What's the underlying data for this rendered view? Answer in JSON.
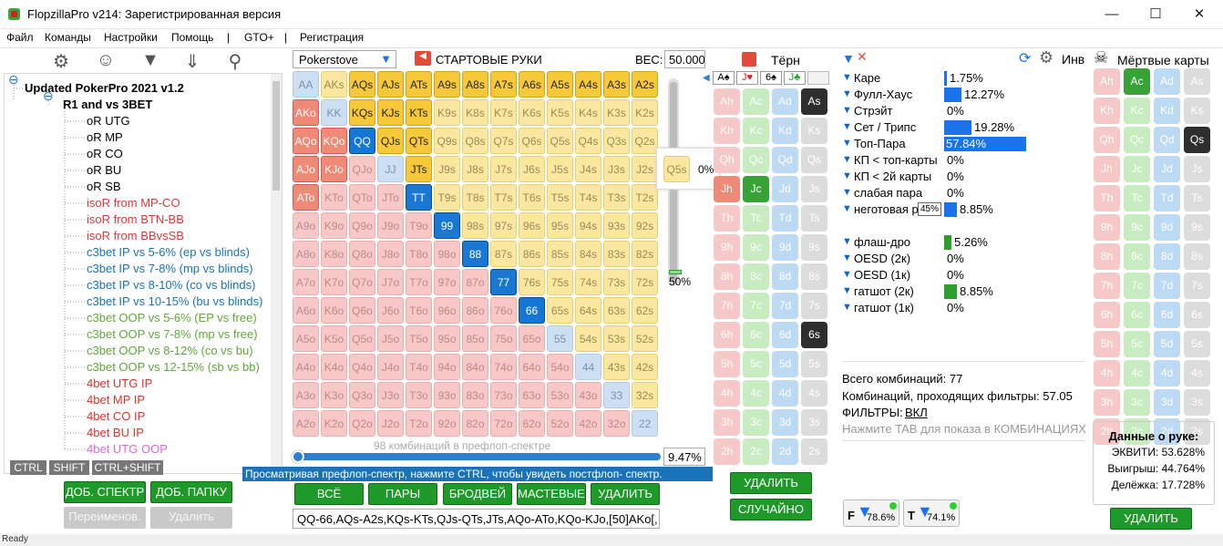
{
  "window": {
    "title": "FlopzillaPro v214: Зарегистрированная версия"
  },
  "menu": [
    "Файл",
    "Команды",
    "Настройки",
    "Помощь",
    "|",
    "GTO+",
    "|",
    "Регистрация"
  ],
  "tree": {
    "root": "Updated PokerPro 2021 v1.2",
    "sub": "R1 and vs 3BET",
    "items": [
      {
        "label": "oR UTG",
        "color": "#000000"
      },
      {
        "label": "oR MP",
        "color": "#000000"
      },
      {
        "label": "oR CO",
        "color": "#000000"
      },
      {
        "label": "oR BU",
        "color": "#000000"
      },
      {
        "label": "oR SB",
        "color": "#000000"
      },
      {
        "label": "isoR from MP-CO",
        "color": "#d83b3b"
      },
      {
        "label": "isoR from BTN-BB",
        "color": "#d83b3b"
      },
      {
        "label": "isoR from BBvsSB",
        "color": "#d83b3b"
      },
      {
        "label": "c3bet IP vs 5-6% (ep vs blinds)",
        "color": "#1a73b8"
      },
      {
        "label": "c3bet IP vs 7-8% (mp vs blinds)",
        "color": "#1a73b8"
      },
      {
        "label": "c3bet IP vs 8-10% (co vs blinds)",
        "color": "#1a73b8"
      },
      {
        "label": "c3bet IP vs 10-15% (bu vs blinds)",
        "color": "#1a73b8"
      },
      {
        "label": "c3bet OOP vs 5-6% (EP vs free)",
        "color": "#5fa83a"
      },
      {
        "label": "c3bet OOP vs 7-8% (mp vs free)",
        "color": "#5fa83a"
      },
      {
        "label": "c3bet OOP vs 8-12% (co vs bu)",
        "color": "#5fa83a"
      },
      {
        "label": "c3bet OOP vs 12-15% (sb vs bb)",
        "color": "#5fa83a"
      },
      {
        "label": "4bet UTG IP",
        "color": "#e0322b"
      },
      {
        "label": "4bet MP IP",
        "color": "#e0322b"
      },
      {
        "label": "4bet CO IP",
        "color": "#e0322b"
      },
      {
        "label": "4bet BU IP",
        "color": "#e0322b"
      },
      {
        "label": "4bet UTG OOP",
        "color": "#d56bd8"
      }
    ]
  },
  "keys": [
    "CTRL",
    "SHIFT",
    "CTRL+SHIFT"
  ],
  "leftButtons": {
    "add_spectrum": "ДОБ. СПЕКТР",
    "add_folder": "ДОБ. ПАПКУ",
    "rename": "Переименов.",
    "delete": "Удалить"
  },
  "range": {
    "preset": "Pokerstove",
    "title": "СТАРТОВЫЕ РУКИ",
    "weight_label": "ВЕС:",
    "weight": "50.000",
    "slider_pct": "50%",
    "combos_text": "98 комбинаций в префлоп-спектре",
    "pct": "9.47%",
    "hint": "Просматривая префлоп-спектр, нажмите CTRL, чтобы увидеть постфлоп- спектр.",
    "range_text": "QQ-66,AQs-A2s,KQs-KTs,QJs-QTs,JTs,AQo-ATo,KQo-KJo,[50]AKo[,",
    "tooltip_hand": "Q5s",
    "tooltip_pct": "0%"
  },
  "rangeButtons": [
    "ВСЁ",
    "ПАРЫ",
    "БРОДВЕЙ",
    "МАСТЕВЫЕ",
    "УДАЛИТЬ"
  ],
  "ranks": [
    "A",
    "K",
    "Q",
    "J",
    "T",
    "9",
    "8",
    "7",
    "6",
    "5",
    "4",
    "3",
    "2"
  ],
  "selected": [
    "AQs",
    "AJs",
    "ATs",
    "A9s",
    "A8s",
    "A7s",
    "A6s",
    "A5s",
    "A4s",
    "A3s",
    "A2s",
    "KQs",
    "KJs",
    "KTs",
    "QJs",
    "QTs",
    "JTs",
    "AKo",
    "AQo",
    "AJo",
    "ATo",
    "KQo",
    "KJo",
    "QQ",
    "TT",
    "99",
    "88",
    "77",
    "66"
  ],
  "turn": {
    "title": "Тёрн",
    "board": [
      "A♠",
      "J♥",
      "6♠",
      "J♣"
    ],
    "delete": "УДАЛИТЬ",
    "random": "СЛУЧАЙНО"
  },
  "turnCards": {
    "selected": [
      "As",
      "Jh",
      "Jc",
      "6s"
    ]
  },
  "stats": {
    "inv_label": "Инв",
    "rows": [
      {
        "label": "Каре",
        "pct": "1.75%",
        "v": 1.75,
        "color": "#1a73e8"
      },
      {
        "label": "Фулл-Хаус",
        "pct": "12.27%",
        "v": 12.27,
        "color": "#1a73e8"
      },
      {
        "label": "Стрэйт",
        "pct": "0%",
        "v": 0,
        "color": "#1a73e8"
      },
      {
        "label": "Сет / Трипс",
        "pct": "19.28%",
        "v": 19.28,
        "color": "#1a73e8"
      },
      {
        "label": "Топ-Пара",
        "pct": "57.84%",
        "v": 57.84,
        "color": "#1a73e8"
      },
      {
        "label": "КП < топ-карты",
        "pct": "0%",
        "v": 0,
        "color": "#1a73e8"
      },
      {
        "label": "КП < 2й карты",
        "pct": "0%",
        "v": 0,
        "color": "#1a73e8"
      },
      {
        "label": "слабая пара",
        "pct": "0%",
        "v": 0,
        "color": "#1a73e8"
      },
      {
        "label": "неготовая рука",
        "pct": "8.85%",
        "v": 8.85,
        "color": "#1a73e8"
      },
      {
        "label": "флаш-дро",
        "pct": "5.26%",
        "v": 5.26,
        "color": "#2e9e2e"
      },
      {
        "label": "OESD (2к)",
        "pct": "0%",
        "v": 0,
        "color": "#2e9e2e"
      },
      {
        "label": "OESD (1к)",
        "pct": "0%",
        "v": 0,
        "color": "#2e9e2e"
      },
      {
        "label": "гатшот (2к)",
        "pct": "8.85%",
        "v": 8.85,
        "color": "#2e9e2e"
      },
      {
        "label": "гатшот (1к)",
        "pct": "0%",
        "v": 0,
        "color": "#2e9e2e"
      }
    ],
    "bar_tooltip": "45%",
    "total": "Всего комбинаций: 77",
    "passing": "Комбинаций, проходящих фильтры: 57.05",
    "filters_label": "ФИЛЬТРЫ:",
    "filters_value": "ВКЛ",
    "tab_hint": "Нажмите TAB для показа в КОМБИНАЦИЯХ",
    "f1": "78.6%",
    "f2": "74.1%"
  },
  "dead": {
    "title": "Мёртвые карты",
    "delete": "УДАЛИТЬ",
    "selected": [
      "Ac",
      "Qs"
    ]
  },
  "hand": {
    "title": "Данные о руке:",
    "equity": "ЭКВИТИ: 53.628%",
    "win": "Выигрыш: 44.764%",
    "tie": "Делёжка: 17.728%"
  },
  "status": "Ready"
}
